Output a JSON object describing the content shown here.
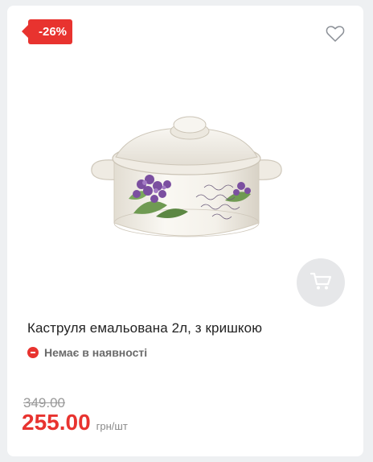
{
  "badge": {
    "discount": "-26%"
  },
  "product": {
    "title": "Каструля емальована 2л, з кришкою",
    "image_alt": "Каструля емальована з фіалками"
  },
  "stock": {
    "status": "Немає в наявності"
  },
  "price": {
    "old": "349.00",
    "current": "255.00",
    "unit": "грн/шт"
  },
  "icons": {
    "favorite": "heart-icon",
    "cart": "cart-icon",
    "stock": "minus-circle-icon"
  },
  "colors": {
    "accent": "#e8332f",
    "muted": "#9a9a9a",
    "cart_bg": "#e6e7e9"
  }
}
